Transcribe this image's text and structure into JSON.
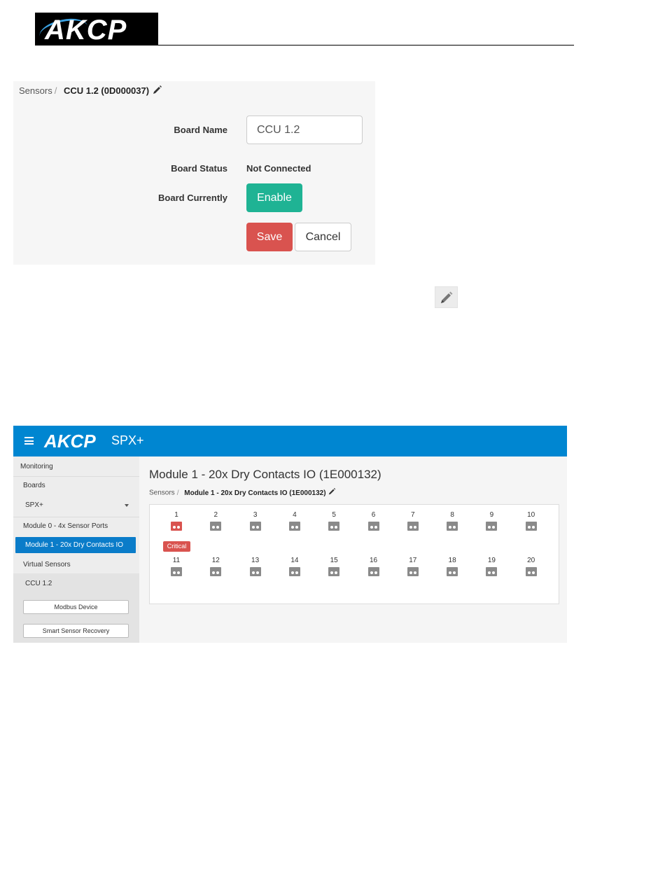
{
  "document": {
    "logo_text": "AKCP"
  },
  "board_form": {
    "breadcrumb_root": "Sensors",
    "breadcrumb_current": "CCU 1.2 (0D000037)",
    "board_name_label": "Board Name",
    "board_name_value": "CCU 1.2",
    "board_status_label": "Board Status",
    "board_status_value": "Not Connected",
    "board_currently_label": "Board Currently",
    "enable_button": "Enable",
    "save_button": "Save",
    "cancel_button": "Cancel"
  },
  "app": {
    "brand": "AKCP",
    "product": "SPX+",
    "sidebar": {
      "monitoring": "Monitoring",
      "boards": "Boards",
      "selected_device": "SPX+",
      "module0": "Module 0 - 4x Sensor Ports",
      "module1": "Module 1 - 20x Dry Contacts IO",
      "virtual_sensors": "Virtual Sensors",
      "ccu": "CCU 1.2",
      "modbus_button": "Modbus Device",
      "recovery_button": "Smart Sensor Recovery"
    },
    "page_title": "Module 1 - 20x Dry Contacts IO (1E000132)",
    "breadcrumb_root": "Sensors",
    "breadcrumb_current": "Module 1 - 20x Dry Contacts IO (1E000132)",
    "critical_badge": "Critical",
    "colors": {
      "accent": "#0086d1",
      "critical": "#d9534f",
      "normal": "#8a8a8a"
    },
    "ports": [
      {
        "n": "1",
        "status": "critical"
      },
      {
        "n": "2",
        "status": "normal"
      },
      {
        "n": "3",
        "status": "normal"
      },
      {
        "n": "4",
        "status": "normal"
      },
      {
        "n": "5",
        "status": "normal"
      },
      {
        "n": "6",
        "status": "normal"
      },
      {
        "n": "7",
        "status": "normal"
      },
      {
        "n": "8",
        "status": "normal"
      },
      {
        "n": "9",
        "status": "normal"
      },
      {
        "n": "10",
        "status": "normal"
      },
      {
        "n": "11",
        "status": "normal"
      },
      {
        "n": "12",
        "status": "normal"
      },
      {
        "n": "13",
        "status": "normal"
      },
      {
        "n": "14",
        "status": "normal"
      },
      {
        "n": "15",
        "status": "normal"
      },
      {
        "n": "16",
        "status": "normal"
      },
      {
        "n": "17",
        "status": "normal"
      },
      {
        "n": "18",
        "status": "normal"
      },
      {
        "n": "19",
        "status": "normal"
      },
      {
        "n": "20",
        "status": "normal"
      }
    ]
  }
}
